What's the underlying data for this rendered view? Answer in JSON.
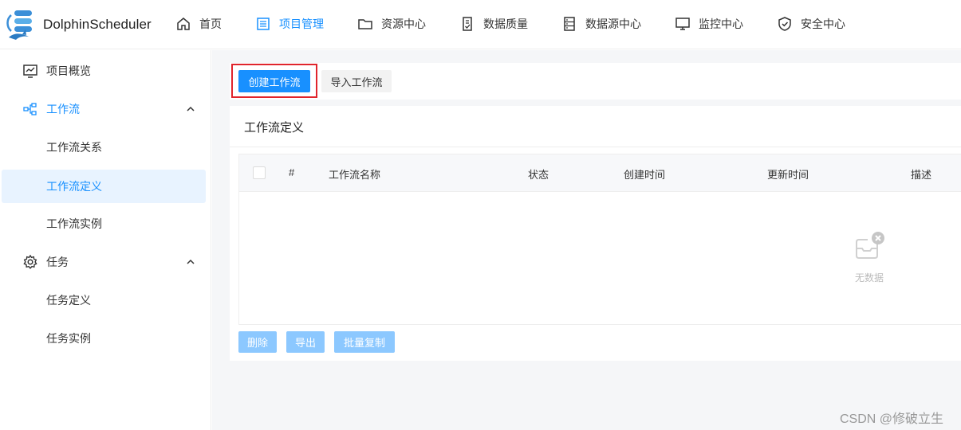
{
  "app": {
    "name": "DolphinScheduler"
  },
  "nav": [
    {
      "label": "首页",
      "icon": "home-icon",
      "active": false
    },
    {
      "label": "项目管理",
      "icon": "project-list-icon",
      "active": true
    },
    {
      "label": "资源中心",
      "icon": "folder-icon",
      "active": false
    },
    {
      "label": "数据质量",
      "icon": "document-check-icon",
      "active": false
    },
    {
      "label": "数据源中心",
      "icon": "database-icon",
      "active": false
    },
    {
      "label": "监控中心",
      "icon": "monitor-icon",
      "active": false
    },
    {
      "label": "安全中心",
      "icon": "shield-icon",
      "active": false
    }
  ],
  "sidebar": {
    "items": [
      {
        "label": "项目概览",
        "icon": "chart-overview-icon"
      },
      {
        "label": "工作流",
        "icon": "workflow-icon",
        "expanded": true
      },
      {
        "label": "工作流关系"
      },
      {
        "label": "工作流定义",
        "selected": true
      },
      {
        "label": "工作流实例"
      },
      {
        "label": "任务",
        "icon": "gear-icon",
        "expanded": true
      },
      {
        "label": "任务定义"
      },
      {
        "label": "任务实例"
      }
    ]
  },
  "toolbar": {
    "create_label": "创建工作流",
    "import_label": "导入工作流"
  },
  "card": {
    "title": "工作流定义"
  },
  "table": {
    "columns": [
      "#",
      "工作流名称",
      "状态",
      "创建时间",
      "更新时间",
      "描述"
    ],
    "rows": [],
    "empty_text": "无数据"
  },
  "actions": {
    "delete_label": "删除",
    "export_label": "导出",
    "batch_copy_label": "批量复制"
  },
  "watermark": "CSDN @修破立生",
  "colors": {
    "accent": "#1890ff",
    "selected_bg": "#e8f3ff",
    "highlight_border": "#e0242c",
    "disabled_button": "#8cc8ff"
  }
}
